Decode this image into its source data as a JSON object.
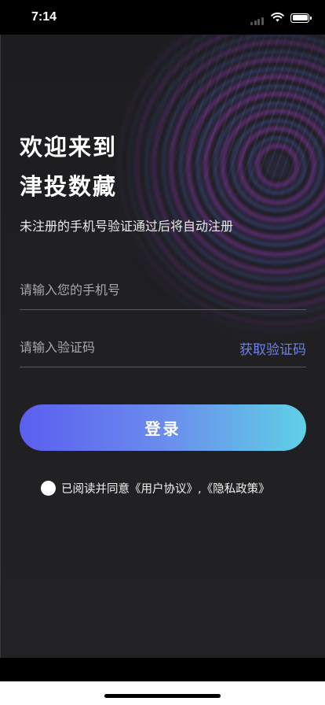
{
  "status_bar": {
    "time": "7:14",
    "icons": [
      "signal-icon",
      "wifi-icon",
      "battery-icon"
    ]
  },
  "welcome": {
    "line1": "欢迎来到",
    "line2": "津投数藏",
    "subtitle": "未注册的手机号验证通过后将自动注册"
  },
  "form": {
    "phone_placeholder": "请输入您的手机号",
    "phone_value": "",
    "code_placeholder": "请输入验证码",
    "code_value": "",
    "get_code_label": "获取验证码"
  },
  "login_label": "登录",
  "agreement": {
    "text": "已阅读并同意《用户协议》,《隐私政策》",
    "checked": false
  },
  "colors": {
    "accent_link": "#6a82e6",
    "button_gradient_start": "#5b5ff0",
    "button_gradient_end": "#5fd0e6",
    "background": "#1f1f22"
  }
}
